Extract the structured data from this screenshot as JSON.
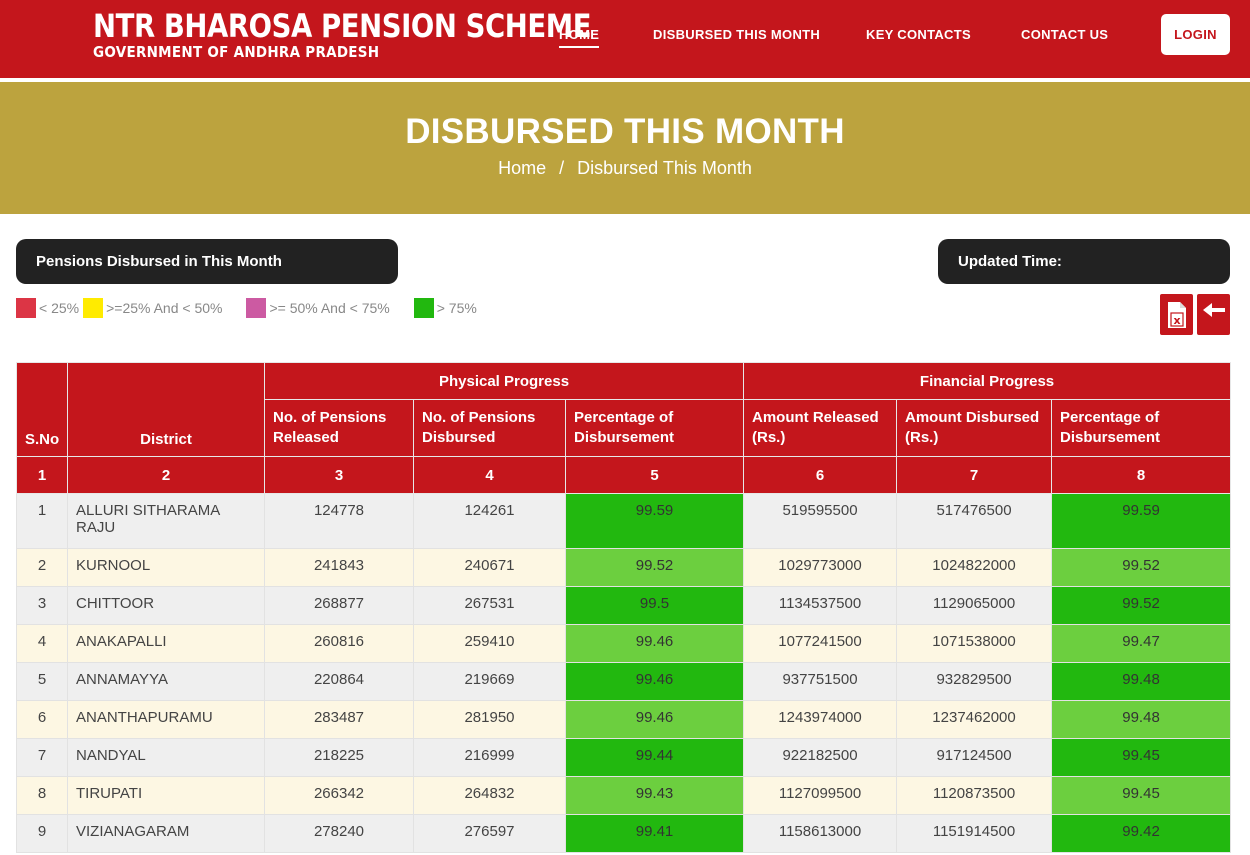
{
  "header": {
    "title": "NTR BHAROSA PENSION SCHEME",
    "subtitle": "GOVERNMENT OF ANDHRA PRADESH",
    "nav": [
      "HOME",
      "DISBURSED THIS MONTH",
      "KEY CONTACTS",
      "CONTACT US"
    ],
    "login": "LOGIN"
  },
  "banner": {
    "title": "DISBURSED THIS MONTH",
    "crumb_home": "Home",
    "crumb_sep": "/",
    "crumb_current": "Disbursed This Month"
  },
  "info": {
    "left": "Pensions Disbursed in This Month",
    "right": "Updated Time:"
  },
  "legend": [
    {
      "label": "< 25%",
      "color": "#dc3545"
    },
    {
      "label": ">=25% And < 50%",
      "color": "#ffeb00"
    },
    {
      "label": ">= 50% And < 75%",
      "color": "#cc5aa2"
    },
    {
      "label": "> 75%",
      "color": "#22b80f"
    }
  ],
  "icons": {
    "excel": "excel-export-icon",
    "back": "back-arrow-icon"
  },
  "table": {
    "group_physical": "Physical Progress",
    "group_financial": "Financial Progress",
    "col_sno": "S.No",
    "col_district": "District",
    "cols": [
      "No. of Pensions Released",
      "No. of Pensions Disbursed",
      "Percentage of Disbursement",
      "Amount Released (Rs.)",
      "Amount Disbursed (Rs.)",
      "Percentage of Disbursement"
    ],
    "col_numbers": [
      "1",
      "2",
      "3",
      "4",
      "5",
      "6",
      "7",
      "8"
    ],
    "rows": [
      [
        "1",
        "ALLURI SITHARAMA RAJU",
        "124778",
        "124261",
        "99.59",
        "519595500",
        "517476500",
        "99.59"
      ],
      [
        "2",
        "KURNOOL",
        "241843",
        "240671",
        "99.52",
        "1029773000",
        "1024822000",
        "99.52"
      ],
      [
        "3",
        "CHITTOOR",
        "268877",
        "267531",
        "99.5",
        "1134537500",
        "1129065000",
        "99.52"
      ],
      [
        "4",
        "ANAKAPALLI",
        "260816",
        "259410",
        "99.46",
        "1077241500",
        "1071538000",
        "99.47"
      ],
      [
        "5",
        "ANNAMAYYA",
        "220864",
        "219669",
        "99.46",
        "937751500",
        "932829500",
        "99.48"
      ],
      [
        "6",
        "ANANTHAPURAMU",
        "283487",
        "281950",
        "99.46",
        "1243974000",
        "1237462000",
        "99.48"
      ],
      [
        "7",
        "NANDYAL",
        "218225",
        "216999",
        "99.44",
        "922182500",
        "917124500",
        "99.45"
      ],
      [
        "8",
        "TIRUPATI",
        "266342",
        "264832",
        "99.43",
        "1127099500",
        "1120873500",
        "99.45"
      ],
      [
        "9",
        "VIZIANAGARAM",
        "278240",
        "276597",
        "99.41",
        "1158613000",
        "1151914500",
        "99.42"
      ]
    ]
  }
}
